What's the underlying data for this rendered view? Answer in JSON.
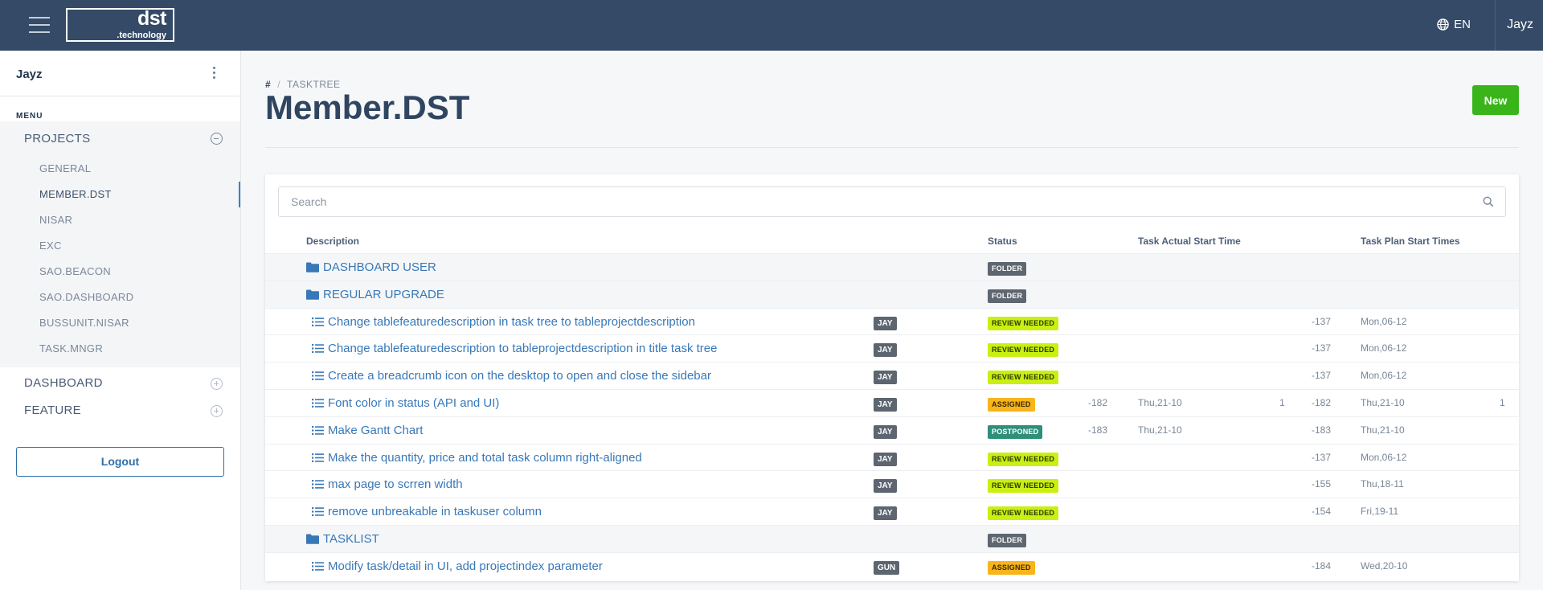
{
  "topbar": {
    "logo_main": "dst",
    "logo_sub": ".technology",
    "language": "EN",
    "user": "Jayz"
  },
  "sidebar": {
    "user": "Jayz",
    "menu_label": "MENU",
    "sections": [
      {
        "label": "PROJECTS",
        "expanded": true,
        "items": [
          "GENERAL",
          "MEMBER.DST",
          "NISAR",
          "EXC",
          "SAO.BEACON",
          "SAO.DASHBOARD",
          "BUSSUNIT.NISAR",
          "TASK.MNGR"
        ],
        "active_item": "MEMBER.DST"
      },
      {
        "label": "DASHBOARD",
        "expanded": false
      },
      {
        "label": "FEATURE",
        "expanded": false
      }
    ],
    "logout_label": "Logout"
  },
  "main": {
    "breadcrumb": {
      "root": "#",
      "current": "TASKTREE"
    },
    "title": "Member.DST",
    "new_button": "New",
    "search_placeholder": "Search",
    "columns": [
      "Description",
      "Status",
      "Task Actual Start Time",
      "Task Plan Start Times"
    ],
    "rows": [
      {
        "type": "folder",
        "description": "DASHBOARD USER",
        "user": "",
        "status": "FOLDER",
        "actual_delta": "",
        "actual_date": "",
        "actual_count": "",
        "plan_delta": "",
        "plan_date": "",
        "plan_count": ""
      },
      {
        "type": "folder",
        "description": "REGULAR UPGRADE",
        "user": "",
        "status": "FOLDER",
        "actual_delta": "",
        "actual_date": "",
        "actual_count": "",
        "plan_delta": "",
        "plan_date": "",
        "plan_count": ""
      },
      {
        "type": "task",
        "description": "Change tablefeaturedescription in task tree to tableprojectdescription",
        "user": "JAY",
        "status": "REVIEW NEEDED",
        "actual_delta": "",
        "actual_date": "",
        "actual_count": "",
        "plan_delta": "-137",
        "plan_date": "Mon,06-12",
        "plan_count": ""
      },
      {
        "type": "task",
        "description": "Change tablefeaturedescription to tableprojectdescription in title task tree",
        "user": "JAY",
        "status": "REVIEW NEEDED",
        "actual_delta": "",
        "actual_date": "",
        "actual_count": "",
        "plan_delta": "-137",
        "plan_date": "Mon,06-12",
        "plan_count": ""
      },
      {
        "type": "task",
        "description": "Create a breadcrumb icon on the desktop to open and close the sidebar",
        "user": "JAY",
        "status": "REVIEW NEEDED",
        "actual_delta": "",
        "actual_date": "",
        "actual_count": "",
        "plan_delta": "-137",
        "plan_date": "Mon,06-12",
        "plan_count": ""
      },
      {
        "type": "task",
        "description": "Font color in status (API and UI)",
        "user": "JAY",
        "status": "ASSIGNED",
        "actual_delta": "-182",
        "actual_date": "Thu,21-10",
        "actual_count": "1",
        "plan_delta": "-182",
        "plan_date": "Thu,21-10",
        "plan_count": "1"
      },
      {
        "type": "task",
        "description": "Make Gantt Chart",
        "user": "JAY",
        "status": "POSTPONED",
        "actual_delta": "-183",
        "actual_date": "Thu,21-10",
        "actual_count": "",
        "plan_delta": "-183",
        "plan_date": "Thu,21-10",
        "plan_count": ""
      },
      {
        "type": "task",
        "description": "Make the quantity, price and total task column right-aligned",
        "user": "JAY",
        "status": "REVIEW NEEDED",
        "actual_delta": "",
        "actual_date": "",
        "actual_count": "",
        "plan_delta": "-137",
        "plan_date": "Mon,06-12",
        "plan_count": ""
      },
      {
        "type": "task",
        "description": "max page to scrren width",
        "user": "JAY",
        "status": "REVIEW NEEDED",
        "actual_delta": "",
        "actual_date": "",
        "actual_count": "",
        "plan_delta": "-155",
        "plan_date": "Thu,18-11",
        "plan_count": ""
      },
      {
        "type": "task",
        "description": "remove unbreakable in taskuser column",
        "user": "JAY",
        "status": "REVIEW NEEDED",
        "actual_delta": "",
        "actual_date": "",
        "actual_count": "",
        "plan_delta": "-154",
        "plan_date": "Fri,19-11",
        "plan_count": ""
      },
      {
        "type": "folder",
        "description": "TASKLIST",
        "user": "",
        "status": "FOLDER",
        "actual_delta": "",
        "actual_date": "",
        "actual_count": "",
        "plan_delta": "",
        "plan_date": "",
        "plan_count": ""
      },
      {
        "type": "task",
        "description": "Modify task/detail in UI, add projectindex parameter",
        "user": "GUN",
        "status": "ASSIGNED",
        "actual_delta": "",
        "actual_date": "",
        "actual_count": "",
        "plan_delta": "-184",
        "plan_date": "Wed,20-10",
        "plan_count": ""
      }
    ]
  },
  "icons": {
    "menu": "hamburger-icon",
    "language": "globe-icon",
    "sidebar_options": "kebab-icon",
    "collapse": "minus-circle-icon",
    "expand": "plus-circle-icon",
    "search": "search-icon",
    "folder": "folder-icon",
    "task": "task-list-icon"
  },
  "colors": {
    "topbar": "#344a66",
    "accent": "#3878b8",
    "new_button": "#39b51a",
    "review_needed": "#c9f012",
    "assigned": "#f7b51b",
    "postponed": "#2f8f7b",
    "folder": "#5e6670"
  }
}
